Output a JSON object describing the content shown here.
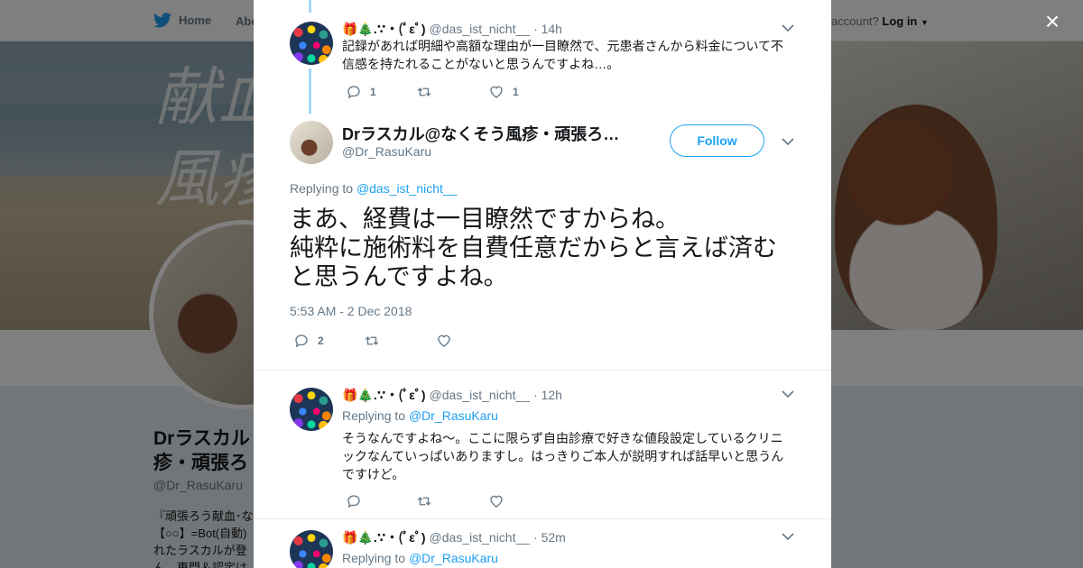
{
  "background": {
    "nav": {
      "home_label": "Home",
      "about_label": "Abo",
      "account_prompt": "account?",
      "login_label": "Log in"
    },
    "banner_text": {
      "line1": "献血",
      "line2": "風疹"
    },
    "profile": {
      "name": "Drラスカル@なくそう風疹・頑張ろ…",
      "name_visible": "Drラスカル 疹・頑張ろ",
      "handle": "@Dr_RasuKaru",
      "bio": "『頑張ろう献血･な 【○○】=Bot(自動) れたラスカルが登 ん、専門＆認定は"
    }
  },
  "modal": {
    "close_label": "×",
    "tweets": [
      {
        "id": "prev",
        "name": "🎁🎄.∵・(ﾟεﾟ)",
        "handle": "@das_ist_nicht__",
        "time": "· 14h",
        "text": "記録があれば明細や高額な理由が一目瞭然で、元患者さんから料金について不信感を持たれることがないと思うんですよね…。",
        "replies": "1",
        "retweets": "",
        "likes": "1"
      },
      {
        "id": "main",
        "name": "Drラスカル@なくそう風疹・頑張ろ…",
        "handle": "@Dr_RasuKaru",
        "follow_label": "Follow",
        "replying_prefix": "Replying to",
        "replying_to": "@das_ist_nicht__",
        "text": "まあ、経費は一目瞭然ですからね。\n純粋に施術料を自費任意だからと言えば済むと思うんですよね。",
        "date": "5:53 AM - 2 Dec 2018",
        "replies": "2",
        "retweets": "",
        "likes": ""
      },
      {
        "id": "reply1",
        "name": "🎁🎄.∵・(ﾟεﾟ)",
        "handle": "@das_ist_nicht__",
        "time": "· 12h",
        "replying_prefix": "Replying to",
        "replying_to": "@Dr_RasuKaru",
        "text": "そうなんですよね～。ここに限らず自由診療で好きな値段設定しているクリニックなんていっぱいありますし。はっきりご本人が説明すれば話早いと思うんですけど。",
        "replies": "",
        "retweets": "",
        "likes": ""
      },
      {
        "id": "reply2",
        "name": "🎁🎄.∵・(ﾟεﾟ)",
        "handle": "@das_ist_nicht__",
        "time": "· 52m",
        "replying_prefix": "Replying to",
        "replying_to": "@Dr_RasuKaru"
      }
    ]
  },
  "colors": {
    "accent": "#1da1f2",
    "thread_line": "#a6d8f7",
    "secondary_text": "#657786"
  }
}
